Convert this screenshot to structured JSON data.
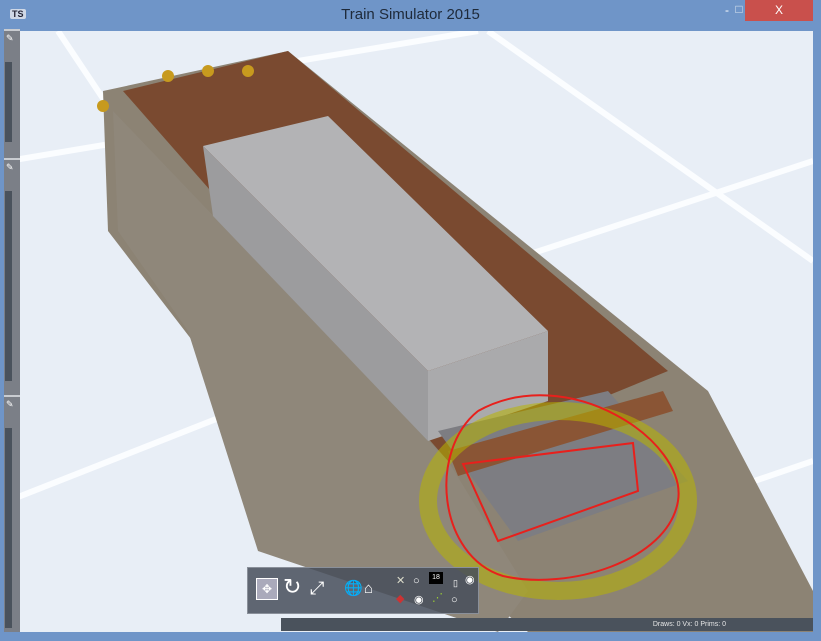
{
  "window": {
    "title": "Train Simulator 2015",
    "app_icon": "TS",
    "minimize": "-",
    "maximize": "□",
    "close": "X"
  },
  "toolbar": {
    "counter": "18",
    "icons": [
      "move-icon",
      "rotate-icon",
      "scale-icon",
      "globe-icon",
      "home-icon",
      "track-icon",
      "radio-icon",
      "camera-icon",
      "signal-icon",
      "spline-icon"
    ]
  },
  "status": {
    "text": "Draws: 0 Vx: 0 Prims: 0"
  },
  "colors": {
    "titlebar": "#6f95c8",
    "close": "#c9504c",
    "annotation": "#e8201c",
    "highlight": "#b8b400"
  }
}
